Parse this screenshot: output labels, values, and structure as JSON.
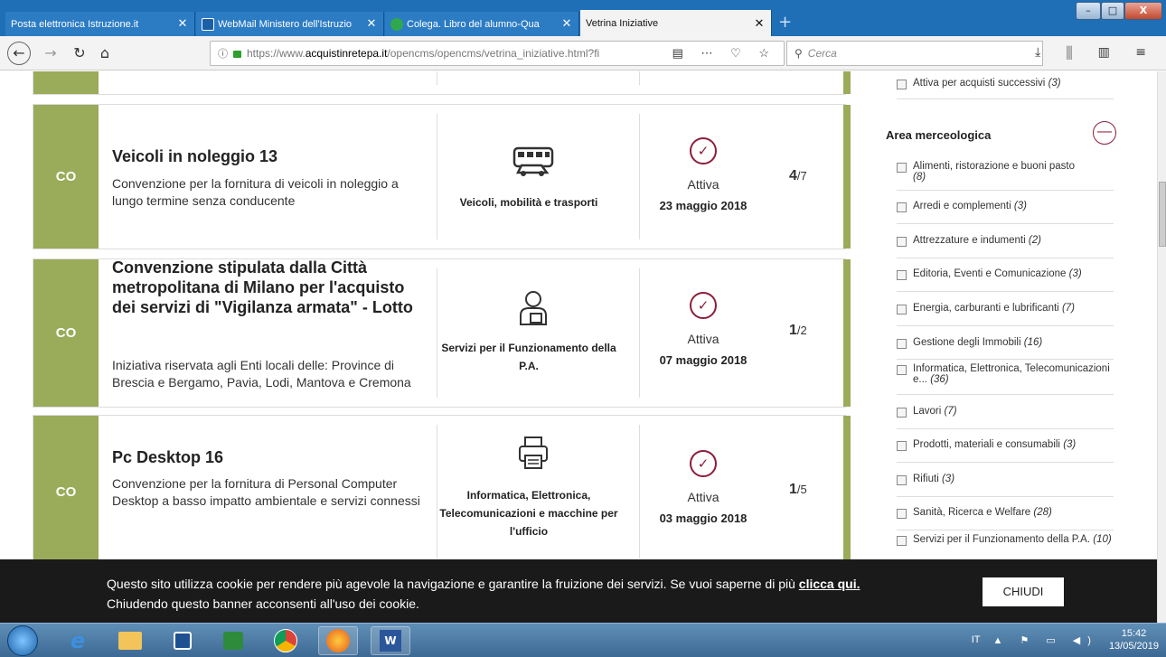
{
  "browser": {
    "tabs": [
      {
        "title": "Posta elettronica Istruzione.it",
        "close": "✕"
      },
      {
        "title": "WebMail Ministero dell'Istruzio",
        "close": "✕"
      },
      {
        "title": "Colega. Libro del alumno-Qua",
        "close": "✕"
      },
      {
        "title": "Vetrina Iniziative",
        "close": "✕"
      }
    ],
    "new_tab": "+",
    "url_prefix": "https://www.",
    "url_host": "acquistinretepa.it",
    "url_path": "/opencms/opencms/vetrina_iniziative.html?fi",
    "search_placeholder": "Cerca",
    "window_controls": {
      "minimize": "–",
      "maximize": "□",
      "close": "X"
    }
  },
  "cards": [
    {
      "tag": "CO",
      "title": "Veicoli in noleggio 13",
      "description": "Convenzione per la fornitura di veicoli in noleggio a lungo termine senza conducente",
      "category_icon": "bus-car-icon",
      "category": "Veicoli, mobilità e trasporti",
      "status": "Attiva",
      "date": "23 maggio 2018",
      "count_current": "4",
      "count_total": "/7"
    },
    {
      "tag": "CO",
      "title": "Convenzione stipulata dalla Città metropolitana di Milano per l'acquisto dei servizi di \"Vigilanza armata\" - Lotto",
      "description": "Iniziativa riservata agli Enti locali delle: Province di Brescia e Bergamo, Pavia, Lodi, Mantova e Cremona",
      "category_icon": "person-service-icon",
      "category": "Servizi per il Funzionamento della P.A.",
      "status": "Attiva",
      "date": "07 maggio 2018",
      "count_current": "1",
      "count_total": "/2"
    },
    {
      "tag": "CO",
      "title": "Pc Desktop 16",
      "description": "Convenzione per la fornitura di Personal Computer Desktop a basso impatto ambientale e servizi connessi",
      "category_icon": "printer-icon",
      "category": "Informatica, Elettronica, Telecomunicazioni e macchine per l'ufficio",
      "status": "Attiva",
      "date": "03 maggio 2018",
      "count_current": "1",
      "count_total": "/5"
    }
  ],
  "sidebar": {
    "top_filter": {
      "label": "Attiva per acquisti successivi",
      "count": "(3)"
    },
    "heading": "Area merceologica",
    "collapse": "—",
    "filters": [
      {
        "label": "Alimenti, ristorazione e buoni pasto",
        "count": "(8)"
      },
      {
        "label": "Arredi e complementi",
        "count": "(3)"
      },
      {
        "label": "Attrezzature e indumenti",
        "count": "(2)"
      },
      {
        "label": "Editoria, Eventi e Comunicazione",
        "count": "(3)"
      },
      {
        "label": "Energia, carburanti e lubrificanti",
        "count": "(7)"
      },
      {
        "label": "Gestione degli Immobili",
        "count": "(16)"
      },
      {
        "label": "Informatica, Elettronica, Telecomunicazioni e...",
        "count": "(36)"
      },
      {
        "label": "Lavori",
        "count": "(7)"
      },
      {
        "label": "Prodotti, materiali e consumabili",
        "count": "(3)"
      },
      {
        "label": "Rifiuti",
        "count": "(3)"
      },
      {
        "label": "Sanità, Ricerca e Welfare",
        "count": "(28)"
      },
      {
        "label": "Servizi per il Funzionamento della P.A.",
        "count": "(10)"
      }
    ]
  },
  "cookie_banner": {
    "text": "Questo sito utilizza cookie per rendere più agevole la navigazione e garantire la fruizione dei servizi. Se vuoi saperne di più ",
    "link": "clicca qui.",
    "text2": "Chiudendo questo banner acconsenti all'uso dei cookie.",
    "button": "CHIUDI"
  },
  "taskbar": {
    "language": "IT",
    "time": "15:42",
    "date": "13/05/2019"
  },
  "colors": {
    "accent_green": "#9aab5a",
    "status_red": "#8c1f3b",
    "tab_blue": "#1f6fb7"
  }
}
